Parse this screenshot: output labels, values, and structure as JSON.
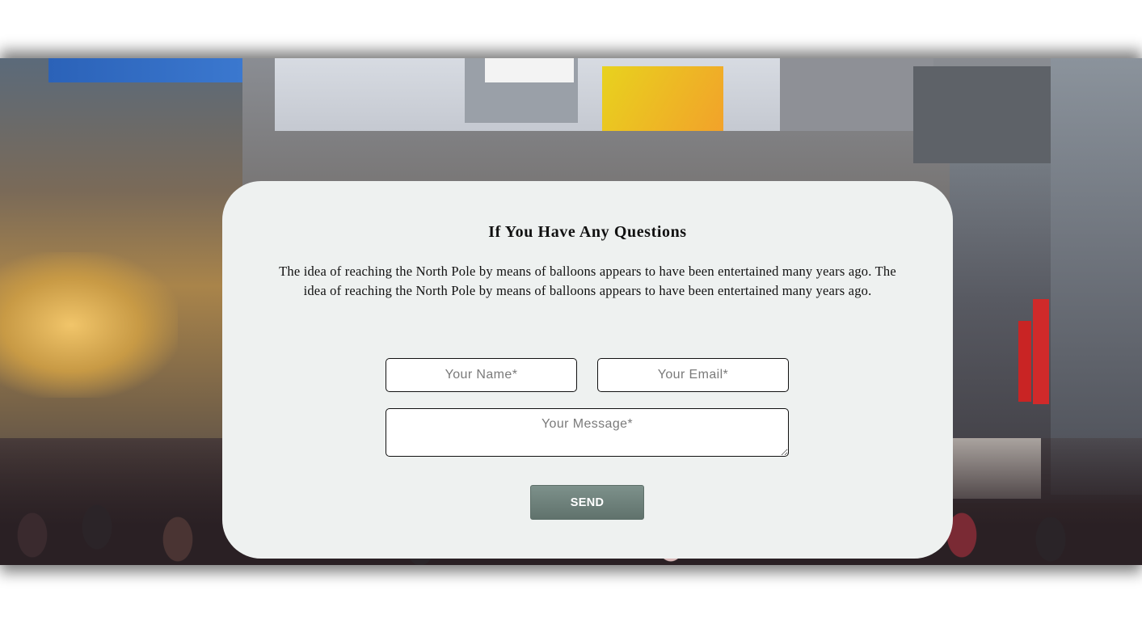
{
  "contact": {
    "title": "If You Have Any Questions",
    "description": "The idea of reaching the North Pole by means of balloons appears to have been entertained many years ago. The idea of reaching the North Pole by means of balloons appears to have been entertained many years ago.",
    "name_placeholder": "Your Name*",
    "email_placeholder": "Your Email*",
    "message_placeholder": "Your Message*",
    "send_label": "SEND"
  },
  "colors": {
    "card_background": "#eef1f0",
    "button_background": "#6f827c",
    "text": "#111111"
  }
}
